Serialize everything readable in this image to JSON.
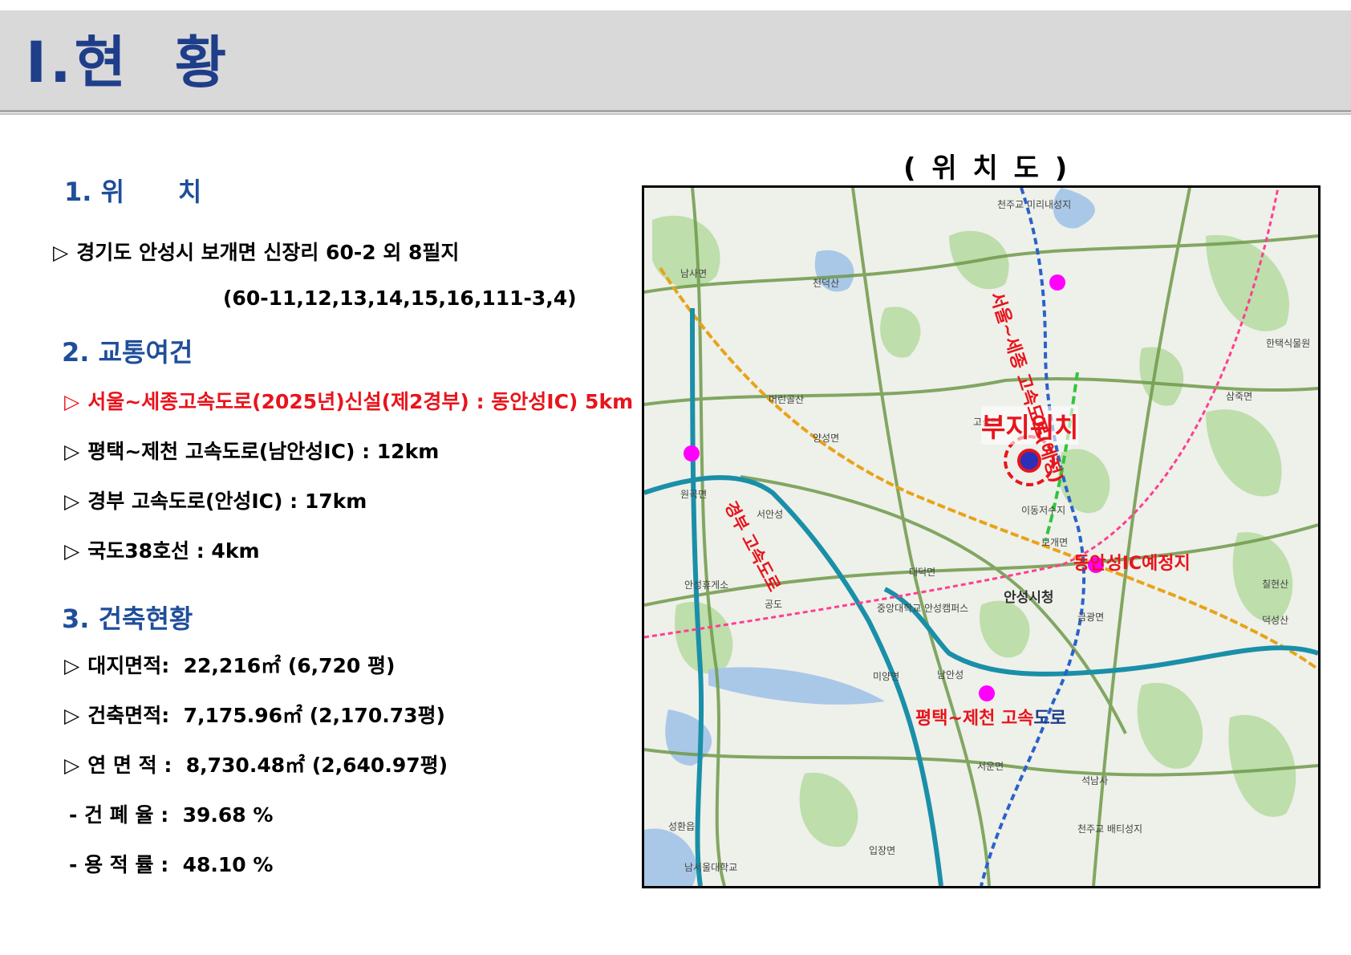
{
  "header": {
    "title": "Ⅰ.현  황"
  },
  "location": {
    "heading": "1. 위      치",
    "marker": "▷",
    "address": "경기도 안성시 보개면 신장리 60-2 외 8필지",
    "parcels": "(60-11,12,13,14,15,16,111-3,4)"
  },
  "traffic": {
    "heading": "2. 교통여건",
    "items": [
      "서울~세종고속도로(2025년)신설(제2경부) : 동안성IC) 5km",
      "평택~제천 고속도로(남안성IC) : 12km",
      "경부 고속도로(안성IC) : 17km",
      "국도38호선 : 4km"
    ]
  },
  "building": {
    "heading": "3. 건축현황",
    "items": [
      "대지면적:  22,216㎡ (6,720 평)",
      "건축면적:  7,175.96㎡ (2,170.73평)",
      "연 면 적 :  8,730.48㎡ (2,640.97평)"
    ],
    "ratios": [
      "- 건 폐 율 :  39.68 %",
      "- 용 적 률 :  48.10 %"
    ]
  },
  "map": {
    "caption": "( 위 치 도 )",
    "site_label": "부지위치",
    "road_labels": {
      "seoul_sejong": "서울~세종 고속도로(예정)",
      "gyeongbu": "경부 고속도로",
      "pyeongtaek_jecheon_a": "평택~제천 고속",
      "pyeongtaek_jecheon_b": "도로",
      "dongansung_ic": "동안성IC예정지"
    },
    "places": [
      "안성시청",
      "보개면",
      "양성면",
      "고삼면",
      "삼죽면",
      "금광면",
      "미양면",
      "대덕면",
      "공도",
      "원곡면",
      "서운면",
      "입장면",
      "성환읍",
      "남사면",
      "천덕산",
      "머린골산",
      "이동저수지",
      "안성휴게소",
      "서안성",
      "남안성",
      "중앙대학교 안성캠퍼스",
      "석남사",
      "남서울대학교",
      "한택식물원",
      "칠현산",
      "덕성산",
      "천주교 미리내성지",
      "천주교 배티성지"
    ],
    "colors": {
      "site_marker": "#e8141c",
      "ic_dot": "#ff00ff",
      "expressway": "#1a8fa8",
      "railway": "#e8a317"
    }
  }
}
